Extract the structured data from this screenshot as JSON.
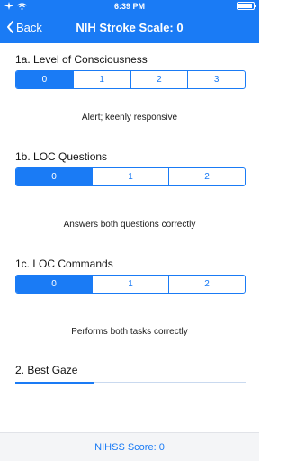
{
  "status_bar": {
    "carrier_icon": "airplane-wifi",
    "time": "6:39 PM"
  },
  "navbar": {
    "back_label": "Back",
    "title": "NIH Stroke Scale: 0"
  },
  "sections": [
    {
      "title": "1a. Level of Consciousness",
      "options": [
        "0",
        "1",
        "2",
        "3"
      ],
      "selected": "0",
      "description": "Alert; keenly responsive"
    },
    {
      "title": "1b. LOC Questions",
      "options": [
        "0",
        "1",
        "2"
      ],
      "selected": "0",
      "description": "Answers both questions correctly"
    },
    {
      "title": "1c. LOC Commands",
      "options": [
        "0",
        "1",
        "2"
      ],
      "selected": "0",
      "description": "Performs both tasks correctly"
    },
    {
      "title": "2. Best Gaze"
    }
  ],
  "footer": {
    "score_label": "NIHSS Score: 0"
  },
  "colors": {
    "accent": "#1a7bf5",
    "footer_bg": "#f4f5f7"
  }
}
